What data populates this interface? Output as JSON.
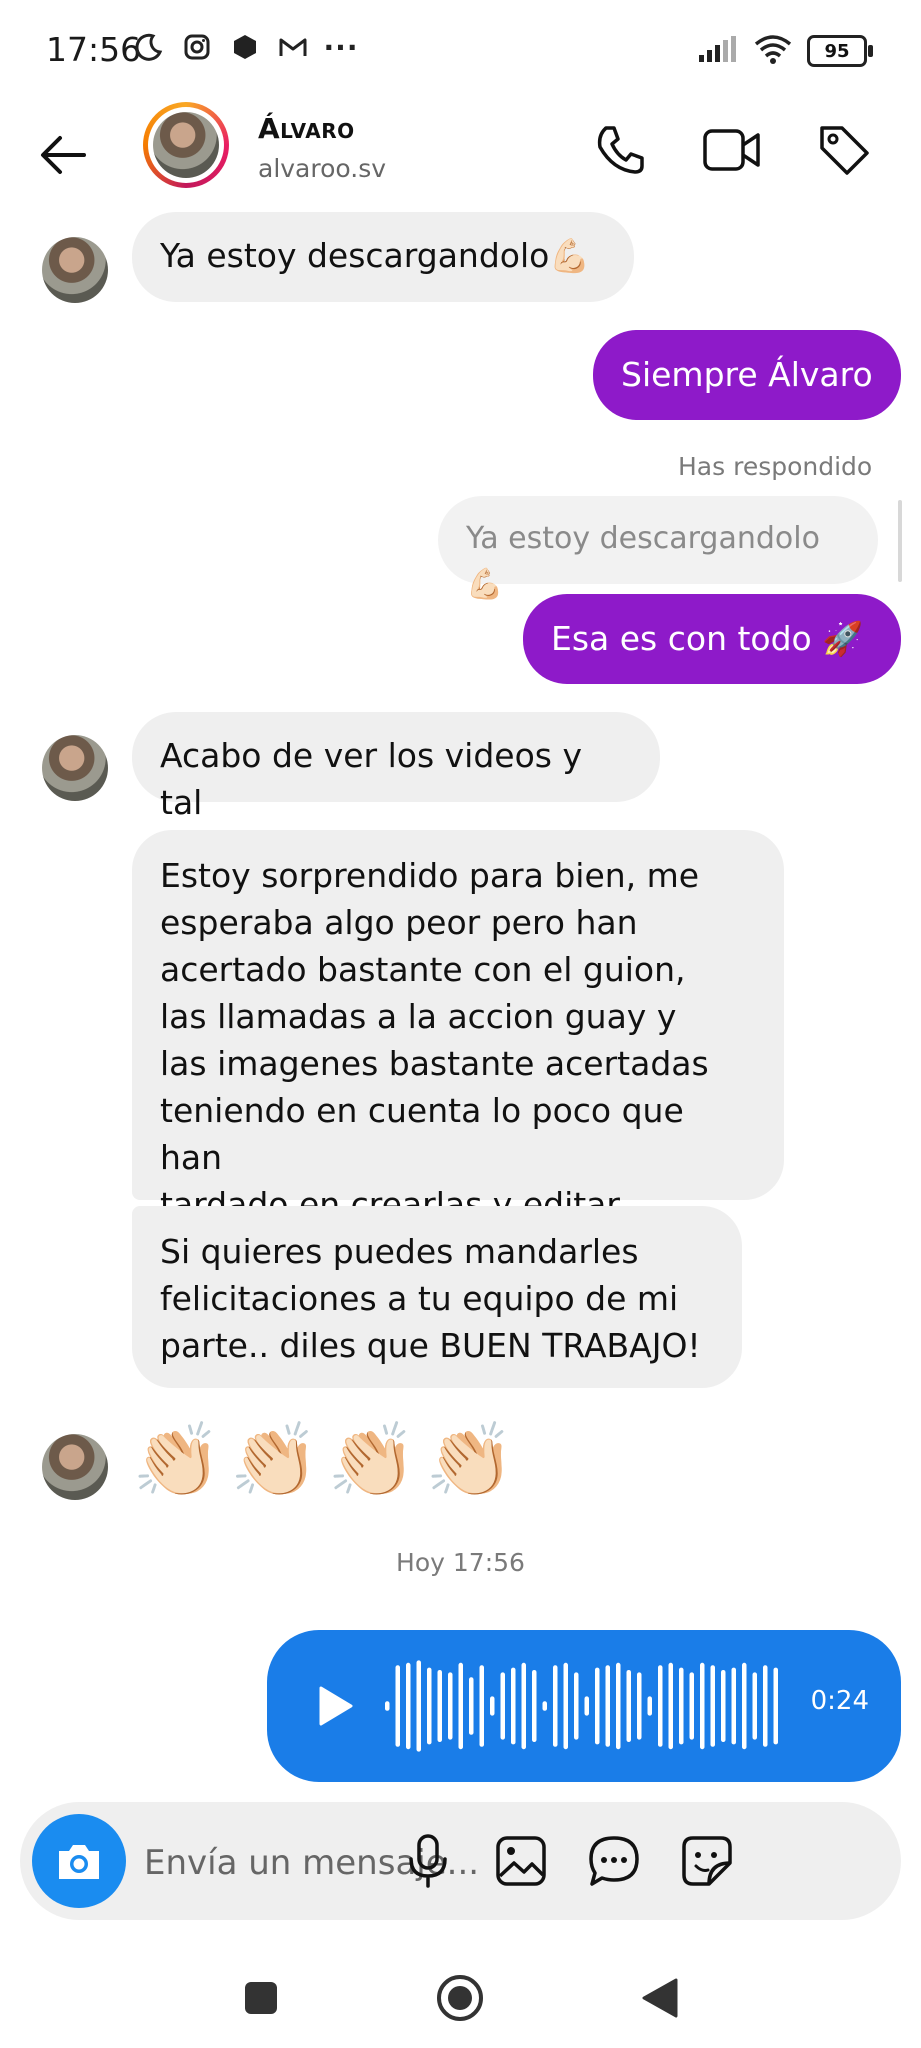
{
  "status_bar": {
    "time": "17:56",
    "battery": "95",
    "overflow": "···"
  },
  "header": {
    "name": "Álvaro",
    "username": "alvaroo.sv",
    "icons": [
      "back-arrow-icon",
      "phone-icon",
      "video-icon",
      "tag-icon"
    ]
  },
  "messages": [
    {
      "from": "them",
      "text": "Ya estoy descargandolo💪🏻"
    },
    {
      "from": "me",
      "text": "Siempre Álvaro"
    },
    {
      "from": "me",
      "reply_label": "Has respondido",
      "reply_to": "Ya estoy descargandolo💪🏻",
      "text": "Esa es con todo 🚀"
    },
    {
      "from": "them",
      "text": "Acabo de ver los videos y tal"
    },
    {
      "from": "them",
      "lines": [
        "Estoy sorprendido para bien, me",
        "esperaba algo peor pero han",
        "acertado bastante con el guion,",
        "las llamadas a la accion guay y",
        "las imagenes bastante acertadas",
        "teniendo en cuenta lo poco que han",
        "tardado en crearlas y editar"
      ]
    },
    {
      "from": "them",
      "lines": [
        "Si quieres puedes mandarles",
        "felicitaciones a tu equipo de mi",
        "parte.. diles que BUEN TRABAJO!"
      ]
    },
    {
      "from": "them",
      "emojis": [
        "👏🏻",
        "👏🏻",
        "👏🏻",
        "👏🏻"
      ]
    }
  ],
  "timestamp": "Hoy 17:56",
  "voice_message": {
    "duration": "0:24",
    "waveform": [
      0.1,
      0.85,
      0.9,
      0.95,
      0.8,
      0.75,
      0.7,
      0.9,
      0.6,
      0.85,
      0.2,
      0.7,
      0.8,
      0.9,
      0.75,
      0.1,
      0.85,
      0.9,
      0.7,
      0.2,
      0.8,
      0.85,
      0.9,
      0.75,
      0.7,
      0.2,
      0.85,
      0.9,
      0.8,
      0.7,
      0.9,
      0.85,
      0.75,
      0.8,
      0.9,
      0.7,
      0.85,
      0.8
    ]
  },
  "composer": {
    "placeholder": "Envía un mensaje...",
    "icons": [
      "camera-icon",
      "microphone-icon",
      "gallery-icon",
      "chat-icon",
      "sticker-icon"
    ]
  },
  "colors": {
    "outgoing": "#8e1ac9",
    "incoming": "#efefef",
    "voice": "#1a7de8",
    "camera": "#1a8cf0"
  }
}
